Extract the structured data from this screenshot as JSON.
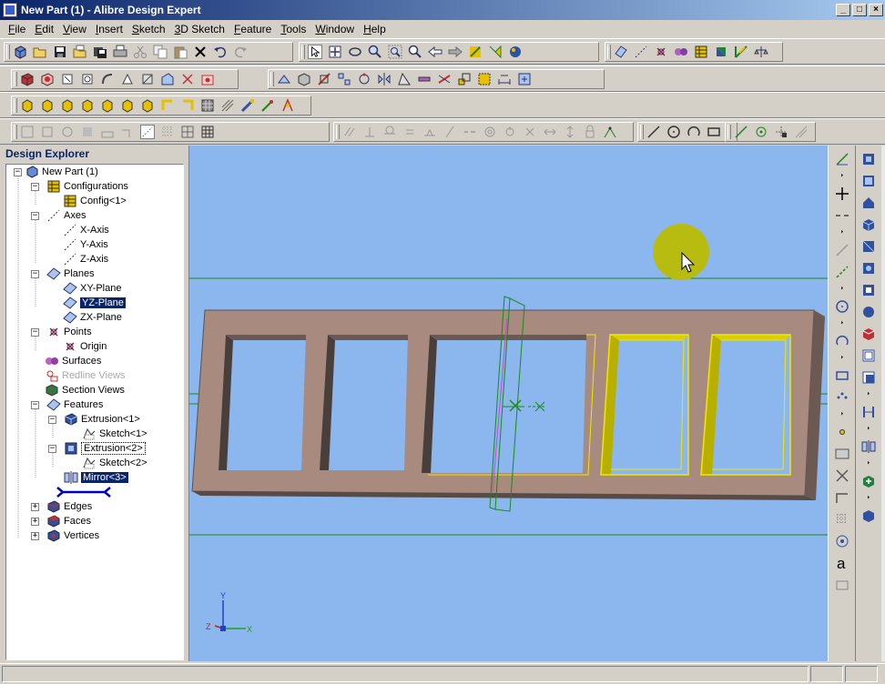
{
  "window": {
    "title": "New Part (1) - Alibre Design Expert",
    "controls": [
      "_",
      "□",
      "×"
    ]
  },
  "menu": [
    {
      "label": "File",
      "key": "F"
    },
    {
      "label": "Edit",
      "key": "E"
    },
    {
      "label": "View",
      "key": "V"
    },
    {
      "label": "Insert",
      "key": "I"
    },
    {
      "label": "Sketch",
      "key": "S"
    },
    {
      "label": "3D Sketch",
      "key": "3"
    },
    {
      "label": "Feature",
      "key": "F"
    },
    {
      "label": "Tools",
      "key": "T"
    },
    {
      "label": "Window",
      "key": "W"
    },
    {
      "label": "Help",
      "key": "H"
    }
  ],
  "explorer": {
    "title": "Design Explorer",
    "tree": {
      "root": "New Part (1)",
      "configurations": "Configurations",
      "config1": "Config<1>",
      "axes": "Axes",
      "x_axis": "X-Axis",
      "y_axis": "Y-Axis",
      "z_axis": "Z-Axis",
      "planes": "Planes",
      "xy_plane": "XY-Plane",
      "yz_plane": "YZ-Plane",
      "zx_plane": "ZX-Plane",
      "points": "Points",
      "origin": "Origin",
      "surfaces": "Surfaces",
      "redline_views": "Redline Views",
      "section_views": "Section Views",
      "features": "Features",
      "extrusion1": "Extrusion<1>",
      "sketch1": "Sketch<1>",
      "extrusion2": "Extrusion<2>",
      "sketch2": "Sketch<2>",
      "mirror3": "Mirror<3>",
      "edges": "Edges",
      "faces": "Faces",
      "vertices": "Vertices"
    }
  },
  "viewport": {
    "background": "#8cb6ee",
    "part_color": "#a88a7e",
    "selection_color": "#f0e800",
    "axis_labels": {
      "y": "Y",
      "z": "Z",
      "x": "X"
    }
  },
  "icons": {
    "toolbar1": [
      "new-part-icon",
      "open-icon",
      "save-icon",
      "open-folder-icon",
      "save-all-icon",
      "print-icon",
      "cut-icon",
      "copy-icon",
      "paste-icon",
      "delete-icon",
      "undo-icon",
      "redo-icon",
      "select-icon",
      "pan-icon",
      "rotate-icon",
      "zoom-in-icon",
      "zoom-window-icon",
      "zoom-fit-icon",
      "previous-view-icon",
      "next-view-icon",
      "sketch-icon",
      "extrude-icon",
      "render-icon",
      "plane-icon",
      "axis-icon",
      "point-icon",
      "mirror-icon",
      "table-icon",
      "design-icon",
      "measure-icon",
      "properties-icon"
    ],
    "right_toolbar": [
      "line-tool-icon",
      "plus-icon",
      "dash-line-icon",
      "centerline-icon",
      "circle-tool-icon",
      "arc-tool-icon",
      "rectangle-tool-icon",
      "dot-icon",
      "grid-icon",
      "text-tool-icon"
    ]
  }
}
